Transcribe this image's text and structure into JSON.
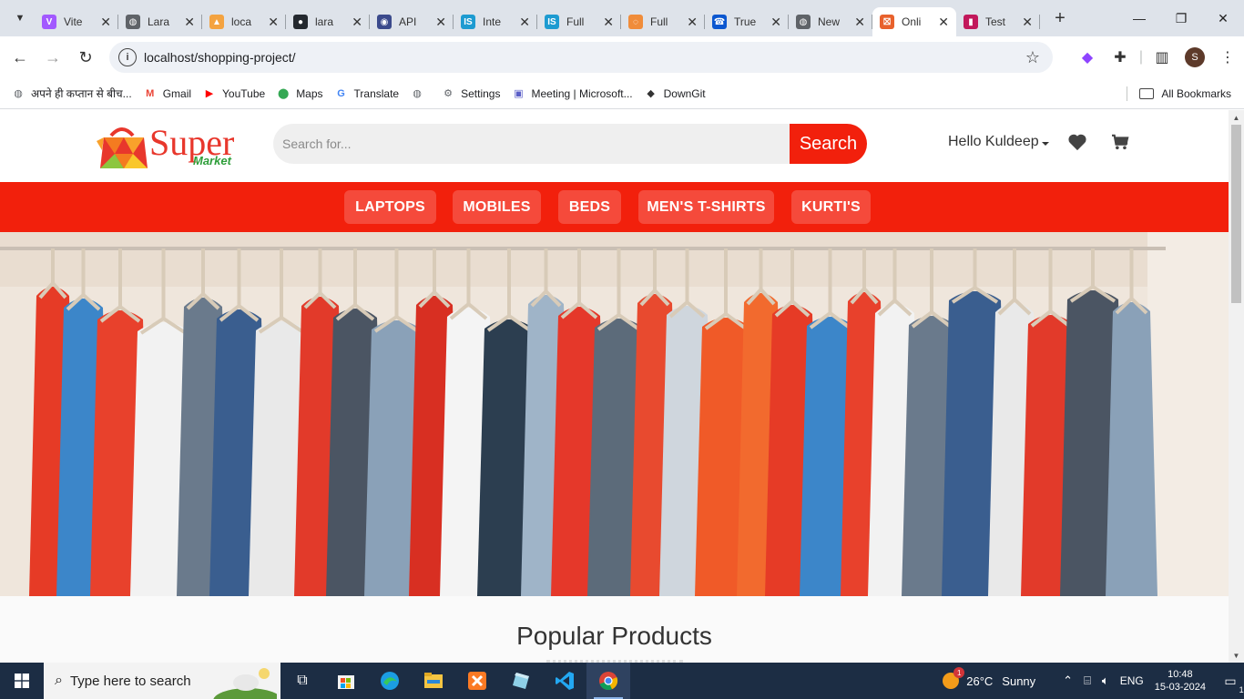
{
  "browser": {
    "tabs": [
      {
        "title": "Vite",
        "fav": "V",
        "color": "#a259ff"
      },
      {
        "title": "Lara",
        "fav": "◍",
        "color": "#5f6368"
      },
      {
        "title": "loca",
        "fav": "▲",
        "color": "#f4a340"
      },
      {
        "title": "lara",
        "fav": "●",
        "color": "#24292f"
      },
      {
        "title": "API",
        "fav": "◉",
        "color": "#3b4a8c"
      },
      {
        "title": "Inte",
        "fav": "IS",
        "color": "#1d9bd1"
      },
      {
        "title": "Full",
        "fav": "IS",
        "color": "#1d9bd1"
      },
      {
        "title": "Full",
        "fav": "◌",
        "color": "#f08c3a"
      },
      {
        "title": "True",
        "fav": "☎",
        "color": "#0b57d0"
      },
      {
        "title": "New",
        "fav": "◍",
        "color": "#5f6368"
      },
      {
        "title": "Onli",
        "fav": "⛝",
        "color": "#e8612c"
      },
      {
        "title": "Test",
        "fav": "▮",
        "color": "#c2185b"
      }
    ],
    "url": "localhost/shopping-project/",
    "profile_initial": "S",
    "bookmarks": [
      {
        "label": "अपने ही कप्तान से बीच...",
        "icon": "◍"
      },
      {
        "label": "Gmail",
        "icon": "M"
      },
      {
        "label": "YouTube",
        "icon": "▶"
      },
      {
        "label": "Maps",
        "icon": "⬤"
      },
      {
        "label": "Translate",
        "icon": "G"
      },
      {
        "label": "",
        "icon": "◍"
      },
      {
        "label": "Settings",
        "icon": "⚙"
      },
      {
        "label": "Meeting | Microsoft...",
        "icon": "▣"
      },
      {
        "label": "DownGit",
        "icon": "◆"
      }
    ],
    "all_bookmarks": "All Bookmarks"
  },
  "site": {
    "logo_word": "Super",
    "logo_sub": "Market",
    "search_placeholder": "Search for...",
    "search_button": "Search",
    "user_greeting": "Hello Kuldeep",
    "accent": "#f2200c",
    "categories": [
      "LAPTOPS",
      "MOBILES",
      "BEDS",
      "MEN'S T-SHIRTS",
      "KURTI'S"
    ],
    "section_title": "Popular Products"
  },
  "taskbar": {
    "search_text": "Type here to search",
    "weather_temp": "26°C",
    "weather_desc": "Sunny",
    "weather_badge": "1",
    "lang": "ENG",
    "time": "10:48",
    "date": "15-03-2024",
    "notif_count": "1"
  }
}
